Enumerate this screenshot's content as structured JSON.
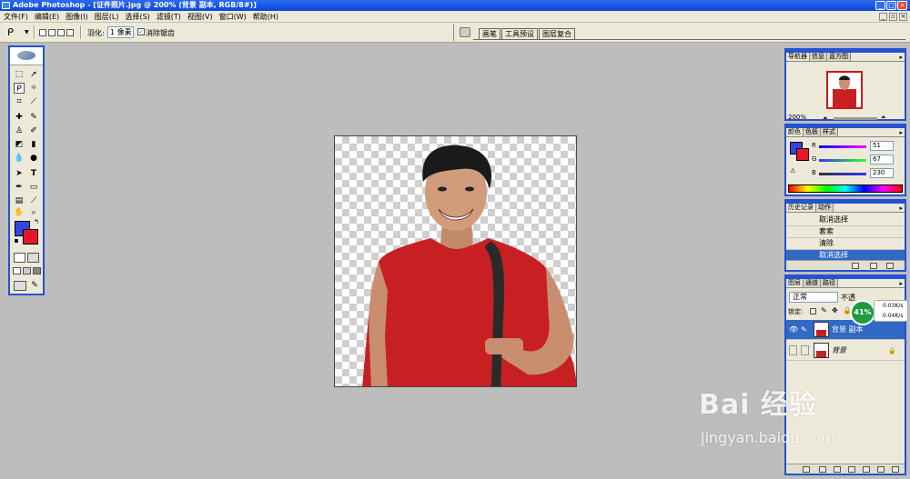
{
  "window": {
    "title": "Adobe Photoshop - [证件照片.jpg @ 200% (背景 副本, RGB/8#)]"
  },
  "menu": [
    "文件(F)",
    "编辑(E)",
    "图像(I)",
    "图层(L)",
    "选择(S)",
    "滤镜(T)",
    "视图(V)",
    "窗口(W)",
    "帮助(H)"
  ],
  "options": {
    "feather_label": "羽化:",
    "feather_value": "1 像素",
    "antialias_label": "消除锯齿"
  },
  "palette_well_tabs": [
    "画笔",
    "工具预设",
    "图层复合"
  ],
  "navigator": {
    "tabs": [
      "导航器",
      "信息",
      "直方图"
    ],
    "zoom": "200%"
  },
  "color": {
    "tabs": [
      "颜色",
      "色板",
      "样式"
    ],
    "channels": [
      {
        "label": "R",
        "value": "51"
      },
      {
        "label": "G",
        "value": "67"
      },
      {
        "label": "B",
        "value": "230"
      }
    ],
    "fg": "#3343e6",
    "bg": "#e81624"
  },
  "history": {
    "tabs": [
      "历史记录",
      "动作"
    ],
    "items": [
      "取消选择",
      "套索",
      "清除",
      "取消选择"
    ]
  },
  "layers": {
    "tabs": [
      "图层",
      "通道",
      "路径"
    ],
    "blend_mode": "正常",
    "opacity_label": "不透",
    "lock_label": "锁定:",
    "items": [
      "背景 副本",
      "背景"
    ]
  },
  "net_monitor": {
    "percent": "41%",
    "up": "0.03K/s",
    "down": "0.04K/s"
  },
  "watermark": {
    "brand": "Bai 经验",
    "url": "jingyan.baidu.com"
  }
}
